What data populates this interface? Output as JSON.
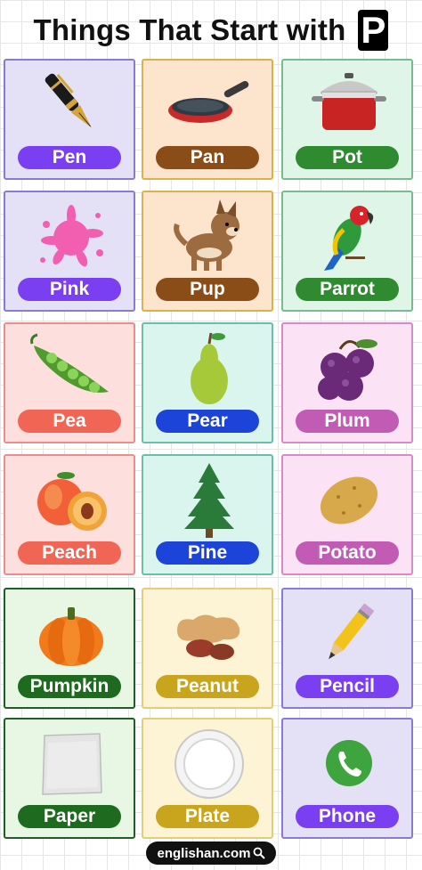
{
  "header": {
    "title": "Things That Start with",
    "letter": "P"
  },
  "cards": [
    {
      "label": "Pen",
      "icon": "pen-icon",
      "bg": "#e4e0f6",
      "border": "#8a7ad1",
      "label_color": "#7a3ff0"
    },
    {
      "label": "Pan",
      "icon": "pan-icon",
      "bg": "#fde4cc",
      "border": "#d8b24a",
      "label_color": "#8a4d17"
    },
    {
      "label": "Pot",
      "icon": "pot-icon",
      "bg": "#def5e7",
      "border": "#79bb8e",
      "label_color": "#2e8b2f"
    },
    {
      "label": "Pink",
      "icon": "paint-splash-icon",
      "bg": "#e4e0f6",
      "border": "#8a7ad1",
      "label_color": "#7a3ff0"
    },
    {
      "label": "Pup",
      "icon": "puppy-icon",
      "bg": "#fde4cc",
      "border": "#d8b24a",
      "label_color": "#8a4d17"
    },
    {
      "label": "Parrot",
      "icon": "parrot-icon",
      "bg": "#def5e7",
      "border": "#79bb8e",
      "label_color": "#2e8b2f"
    },
    {
      "label": "Pea",
      "icon": "pea-pod-icon",
      "bg": "#fde0dd",
      "border": "#e88e8c",
      "label_color": "#f16555"
    },
    {
      "label": "Pear",
      "icon": "pear-icon",
      "bg": "#d9f5ee",
      "border": "#69bfa8",
      "label_color": "#1c44d8"
    },
    {
      "label": "Plum",
      "icon": "plum-icon",
      "bg": "#fbe3f5",
      "border": "#d68bc6",
      "label_color": "#c25bb4"
    },
    {
      "label": "Peach",
      "icon": "peach-icon",
      "bg": "#fde0dd",
      "border": "#e88e8c",
      "label_color": "#f16555"
    },
    {
      "label": "Pine",
      "icon": "pine-tree-icon",
      "bg": "#d9f5ee",
      "border": "#69bfa8",
      "label_color": "#1c44d8"
    },
    {
      "label": "Potato",
      "icon": "potato-icon",
      "bg": "#fbe3f5",
      "border": "#d68bc6",
      "label_color": "#c25bb4"
    },
    {
      "label": "Pumpkin",
      "icon": "pumpkin-icon",
      "bg": "#e8f6e4",
      "border": "#1f5e24",
      "label_color": "#1e6b1f"
    },
    {
      "label": "Peanut",
      "icon": "peanut-icon",
      "bg": "#fdf4d6",
      "border": "#e5cc76",
      "label_color": "#c9a41d"
    },
    {
      "label": "Pencil",
      "icon": "pencil-icon",
      "bg": "#e4e0f6",
      "border": "#8a7ad1",
      "label_color": "#7a3ff0"
    },
    {
      "label": "Paper",
      "icon": "paper-icon",
      "bg": "#e8f6e4",
      "border": "#1f5e24",
      "label_color": "#1e6b1f"
    },
    {
      "label": "Plate",
      "icon": "plate-icon",
      "bg": "#fdf4d6",
      "border": "#e5cc76",
      "label_color": "#c9a41d"
    },
    {
      "label": "Phone",
      "icon": "phone-icon",
      "bg": "#e4e0f6",
      "border": "#8a7ad1",
      "label_color": "#7a3ff0"
    }
  ],
  "footer": {
    "site": "englishan.com",
    "icon": "search-icon"
  }
}
